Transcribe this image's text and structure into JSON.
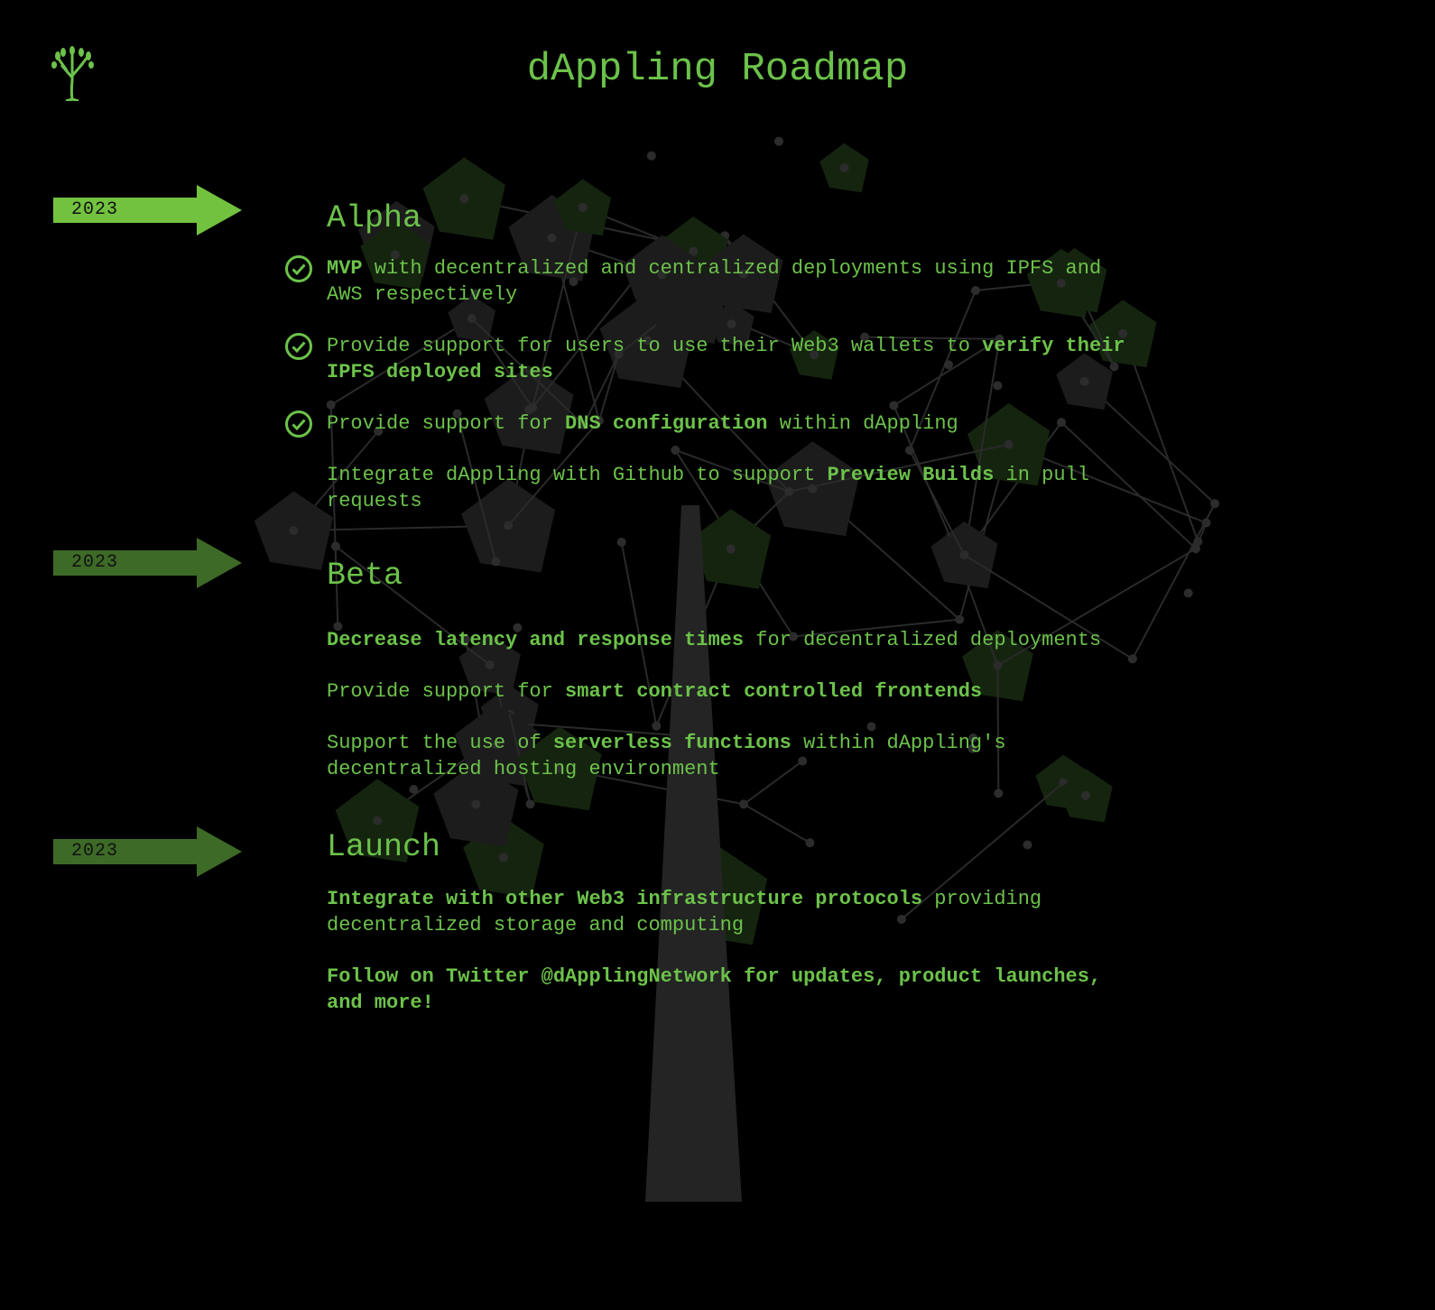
{
  "header": {
    "title": "dAppling Roadmap",
    "logo": "tree-logo"
  },
  "colors": {
    "accent": "#6cc24a",
    "arrow_active": "#72c23f",
    "arrow_dim": "#3d6a26",
    "background": "#000000"
  },
  "sections": [
    {
      "year": "2023",
      "title": "Alpha",
      "active": true,
      "items": [
        {
          "done": true,
          "segments": [
            {
              "text": "MVP",
              "bold": true
            },
            {
              "text": " with decentralized and centralized deployments using IPFS and AWS respectively",
              "bold": false
            }
          ]
        },
        {
          "done": true,
          "segments": [
            {
              "text": "Provide support for users to use their Web3 wallets to ",
              "bold": false
            },
            {
              "text": "verify their IPFS deployed sites",
              "bold": true
            }
          ]
        },
        {
          "done": true,
          "segments": [
            {
              "text": "Provide support for ",
              "bold": false
            },
            {
              "text": "DNS configuration",
              "bold": true
            },
            {
              "text": " within dAppling",
              "bold": false
            }
          ]
        },
        {
          "done": false,
          "segments": [
            {
              "text": "Integrate dAppling with Github to support ",
              "bold": false
            },
            {
              "text": "Preview Builds",
              "bold": true
            },
            {
              "text": " in pull requests",
              "bold": false
            }
          ]
        }
      ]
    },
    {
      "year": "2023",
      "title": "Beta",
      "active": false,
      "items": [
        {
          "done": false,
          "segments": [
            {
              "text": "Decrease latency and response times",
              "bold": true
            },
            {
              "text": " for decentralized deployments",
              "bold": false
            }
          ]
        },
        {
          "done": false,
          "segments": [
            {
              "text": "Provide support for ",
              "bold": false
            },
            {
              "text": "smart contract controlled frontends",
              "bold": true
            }
          ]
        },
        {
          "done": false,
          "segments": [
            {
              "text": "Support the use of ",
              "bold": false
            },
            {
              "text": "serverless functions",
              "bold": true
            },
            {
              "text": " within dAppling's decentralized hosting environment",
              "bold": false
            }
          ]
        }
      ]
    },
    {
      "year": "2023",
      "title": "Launch",
      "active": false,
      "items": [
        {
          "done": false,
          "segments": [
            {
              "text": "Integrate with other Web3 infrastructure protocols",
              "bold": true
            },
            {
              "text": " providing decentralized storage and computing",
              "bold": false
            }
          ]
        },
        {
          "done": false,
          "segments": [
            {
              "text": "Follow on Twitter @dApplingNetwork for updates, product launches, and more!",
              "bold": true
            }
          ]
        }
      ]
    }
  ]
}
